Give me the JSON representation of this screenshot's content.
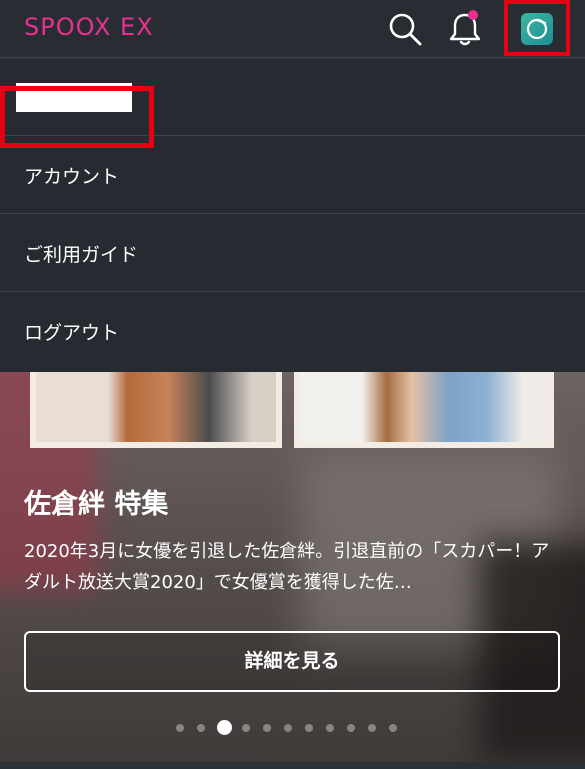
{
  "header": {
    "logo": "SPOOX EX",
    "search_icon": "search-icon",
    "bell_icon": "bell-icon",
    "notification_dot_color": "#e8308f",
    "avatar_icon": "avatar-icon"
  },
  "menu": {
    "items": [
      {
        "label": "アカウント"
      },
      {
        "label": "ご利用ガイド"
      },
      {
        "label": "ログアウト"
      }
    ]
  },
  "feature": {
    "title": "佐倉絆 特集",
    "description": "2020年3月に女優を引退した佐倉絆。引退直前の「スカパー！アダルト放送大賞2020」で女優賞を獲得した佐…",
    "button_label": "詳細を見る"
  },
  "carousel": {
    "count": 11,
    "active_index": 2
  },
  "colors": {
    "brand": "#e8308f",
    "highlight": "#e60012"
  }
}
